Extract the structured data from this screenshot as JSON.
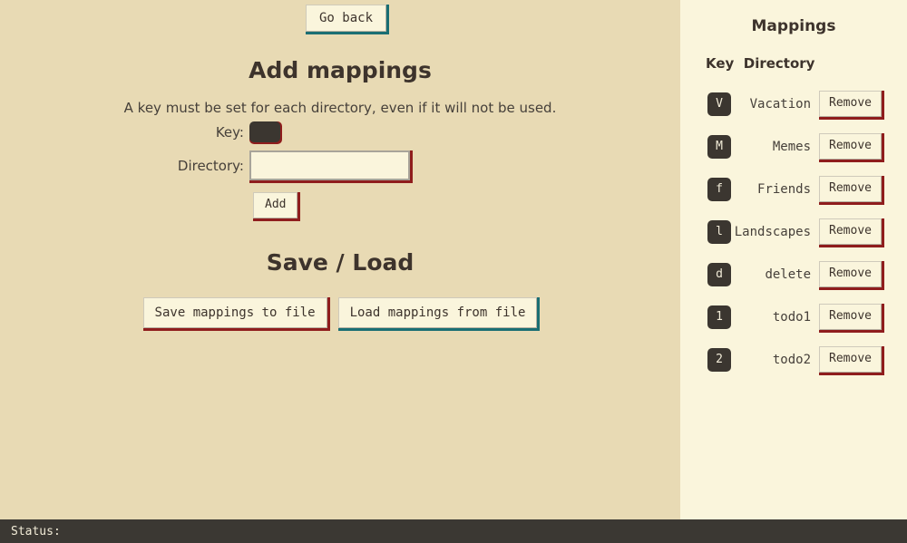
{
  "app": {
    "background_left": "#e8dab4",
    "background_right": "#faf5dc",
    "accent_red": "#8f1d1d",
    "accent_teal": "#1a6e73",
    "text_dark": "#3d332c"
  },
  "left": {
    "go_back_label": "Go back",
    "add_mappings_title": "Add mappings",
    "hint": "A key must be set for each directory, even if it will not be used.",
    "key_label": "Key:",
    "key_value": "",
    "directory_label": "Directory:",
    "directory_value": "",
    "directory_placeholder": "",
    "add_label": "Add",
    "save_load_title": "Save / Load",
    "save_label": "Save mappings to file",
    "load_label": "Load mappings from file"
  },
  "right": {
    "title": "Mappings",
    "columns_header": "Key  Directory",
    "column_key": "Key",
    "column_directory": "Directory",
    "remove_label": "Remove",
    "rows": [
      {
        "key": "V",
        "directory": "Vacation",
        "remove": "Remove"
      },
      {
        "key": "M",
        "directory": "Memes",
        "remove": "Remove"
      },
      {
        "key": "f",
        "directory": "Friends",
        "remove": "Remove"
      },
      {
        "key": "l",
        "directory": "Landscapes",
        "remove": "Remove"
      },
      {
        "key": "d",
        "directory": "delete",
        "remove": "Remove"
      },
      {
        "key": "1",
        "directory": "todo1",
        "remove": "Remove"
      },
      {
        "key": "2",
        "directory": "todo2",
        "remove": "Remove"
      }
    ]
  },
  "status": {
    "text": "Status:"
  }
}
